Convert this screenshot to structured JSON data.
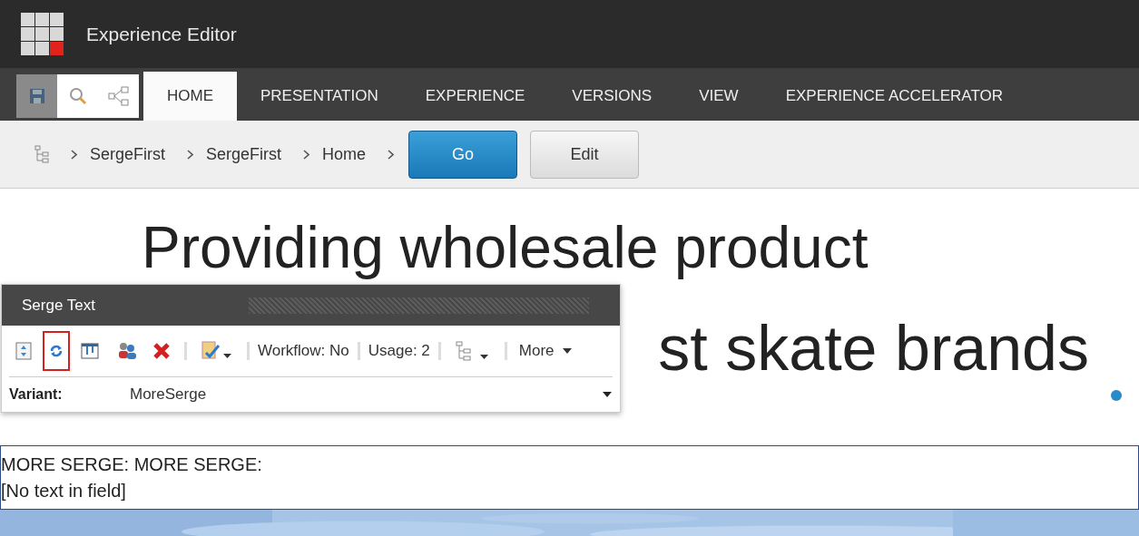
{
  "app": {
    "title": "Experience Editor"
  },
  "quick_actions": [
    {
      "kind": "save",
      "disabled": true
    },
    {
      "kind": "search",
      "disabled": false
    },
    {
      "kind": "share",
      "disabled": false
    }
  ],
  "tabs": [
    {
      "label": "HOME",
      "selected": true
    },
    {
      "label": "PRESENTATION",
      "selected": false
    },
    {
      "label": "EXPERIENCE",
      "selected": false
    },
    {
      "label": "VERSIONS",
      "selected": false
    },
    {
      "label": "VIEW",
      "selected": false
    },
    {
      "label": "EXPERIENCE ACCELERATOR",
      "selected": false
    }
  ],
  "breadcrumb": [
    "SergeFirst",
    "SergeFirst",
    "Home"
  ],
  "buttons": [
    {
      "label": "Go",
      "kind": "primary"
    },
    {
      "label": "Edit",
      "kind": "secondary"
    }
  ],
  "heading": {
    "lines": [
      "Providing wholesale product",
      "st skate brands"
    ]
  },
  "popup": {
    "title": "Serge Text",
    "tools": [
      {
        "kind": "select",
        "selected": false
      },
      {
        "kind": "refresh",
        "selected": true
      },
      {
        "kind": "component",
        "selected": false
      },
      {
        "kind": "personalize",
        "selected": false
      },
      {
        "kind": "delete",
        "selected": false
      },
      {
        "kind": "test",
        "selected": false
      }
    ],
    "workflow": "Workflow: No",
    "usage": "Usage: 2",
    "more": "More",
    "variant_label": "Variant:",
    "variant_value": "MoreSerge"
  },
  "field": {
    "lines": [
      "MORE SERGE: MORE SERGE:",
      "[No text in field]"
    ]
  }
}
